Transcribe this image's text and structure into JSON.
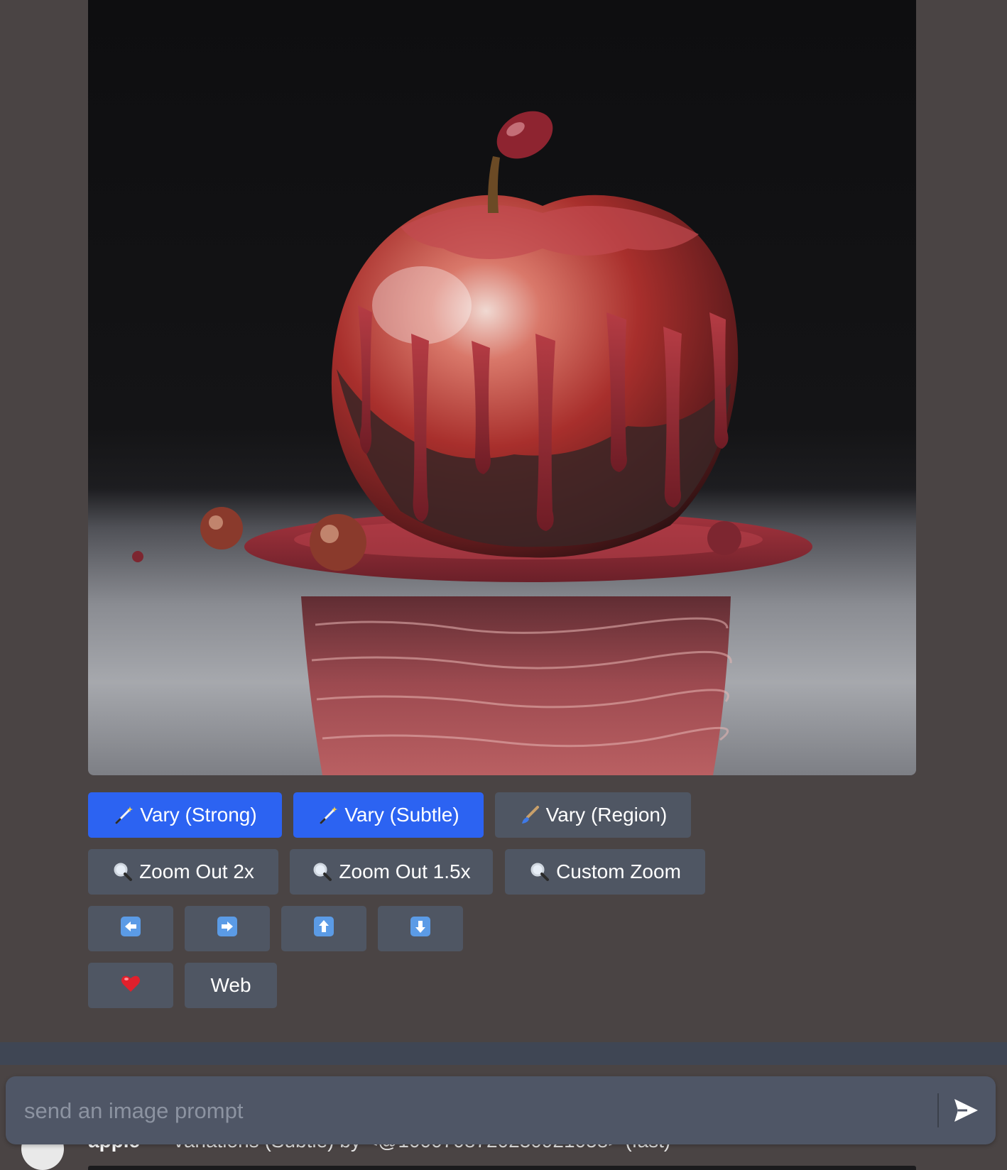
{
  "image": {
    "subject": "apple"
  },
  "actions": {
    "row1": [
      {
        "icon": "magic-wand-icon",
        "label": "Vary (Strong)",
        "selected": true
      },
      {
        "icon": "magic-wand-icon",
        "label": "Vary (Subtle)",
        "selected": true
      },
      {
        "icon": "paintbrush-icon",
        "label": "Vary (Region)",
        "selected": false
      }
    ],
    "row2": [
      {
        "icon": "magnifier-icon",
        "label": "Zoom Out 2x"
      },
      {
        "icon": "magnifier-icon",
        "label": "Zoom Out 1.5x"
      },
      {
        "icon": "magnifier-icon",
        "label": "Custom Zoom"
      }
    ],
    "row3": [
      {
        "icon": "arrow-left-icon"
      },
      {
        "icon": "arrow-right-icon"
      },
      {
        "icon": "arrow-up-icon"
      },
      {
        "icon": "arrow-down-icon"
      }
    ],
    "row4": [
      {
        "icon": "heart-icon"
      },
      {
        "label": "Web"
      }
    ]
  },
  "underlying_message": {
    "prompt": "apple",
    "meta": "- Variations (Subtle) by <@1000708720230921058> (fast)"
  },
  "composer": {
    "placeholder": "send an image prompt",
    "value": "",
    "send_icon": "send-arrow-icon"
  },
  "colors": {
    "background": "#4a4444",
    "primary_button": "#2c63f2",
    "secondary_button": "#4f5663",
    "composer": "#4f5666"
  }
}
